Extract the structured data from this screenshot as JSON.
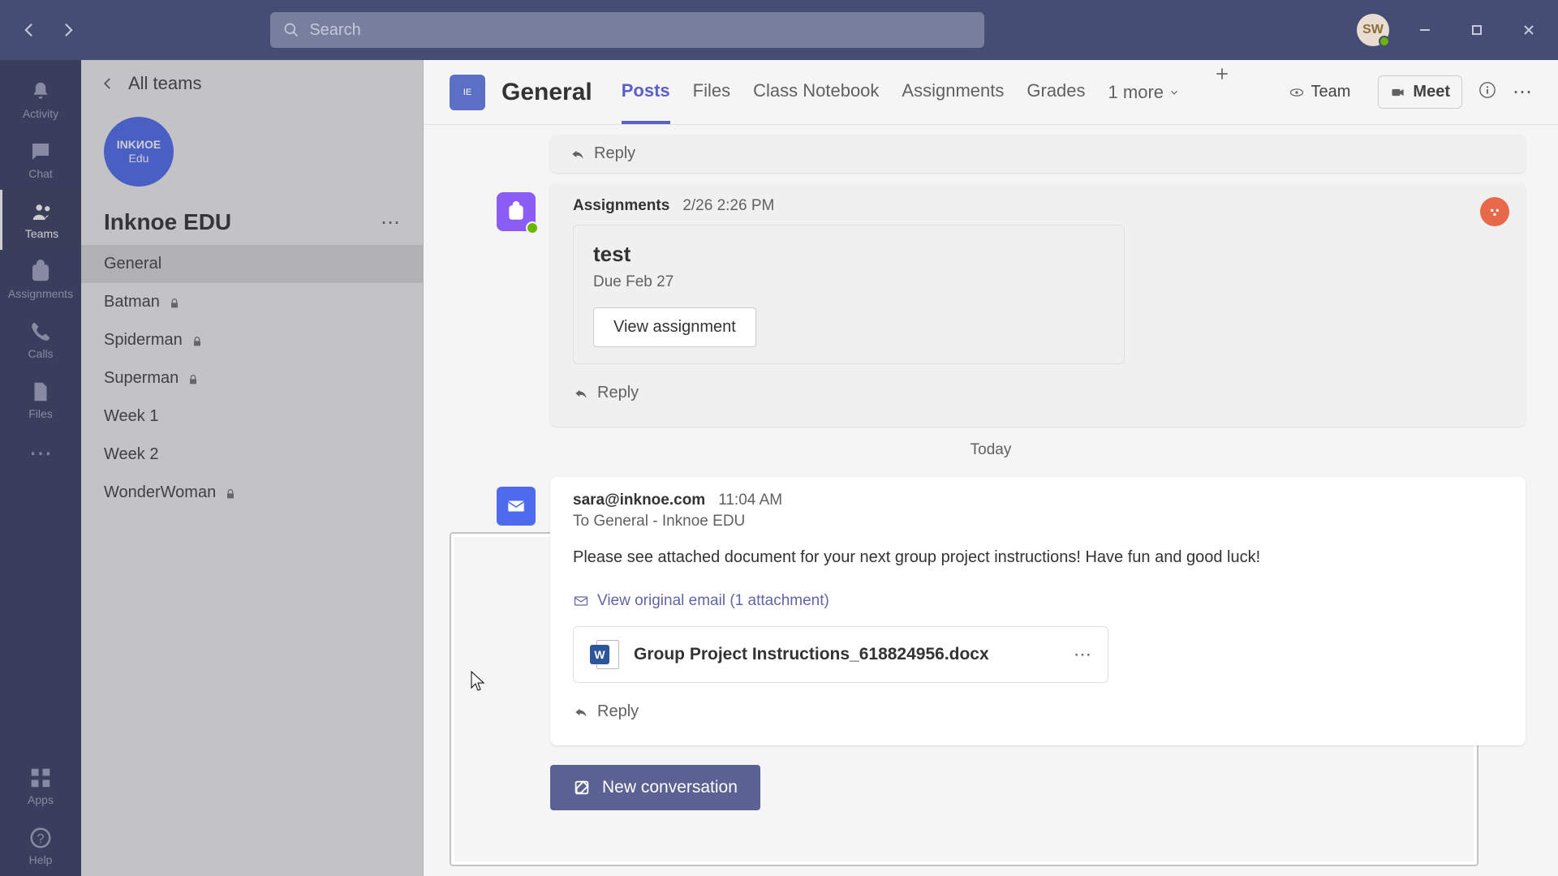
{
  "titlebar": {
    "search_placeholder": "Search",
    "avatar_initials": "SW"
  },
  "rail": {
    "activity": "Activity",
    "chat": "Chat",
    "teams": "Teams",
    "assignments": "Assignments",
    "calls": "Calls",
    "files": "Files",
    "apps": "Apps",
    "help": "Help"
  },
  "sidebar": {
    "all_teams": "All teams",
    "team_avatar_line1": "INKИOE",
    "team_avatar_line2": "Edu",
    "team_name": "Inknoe EDU",
    "channels": [
      {
        "label": "General",
        "locked": false,
        "active": true
      },
      {
        "label": "Batman",
        "locked": true
      },
      {
        "label": "Spiderman",
        "locked": true
      },
      {
        "label": "Superman",
        "locked": true
      },
      {
        "label": "Week 1",
        "locked": false
      },
      {
        "label": "Week 2",
        "locked": false
      },
      {
        "label": "WonderWoman",
        "locked": true
      }
    ]
  },
  "header": {
    "channel_title": "General",
    "tabs": {
      "posts": "Posts",
      "files": "Files",
      "notebook": "Class Notebook",
      "assignments": "Assignments",
      "grades": "Grades",
      "more": "1 more"
    },
    "team_btn": "Team",
    "meet_btn": "Meet"
  },
  "messages": {
    "reply_label": "Reply",
    "assign": {
      "author": "Assignments",
      "time": "2/26 2:26 PM",
      "title": "test",
      "due": "Due Feb 27",
      "view_btn": "View assignment"
    },
    "date_separator": "Today",
    "email": {
      "from": "sara@inknoe.com",
      "time": "11:04 AM",
      "to": "To General - Inknoe EDU",
      "body": "Please see attached document for your next group project instructions! Have fun and good luck!",
      "view_original": "View original email (1 attachment)",
      "attachment_name": "Group Project Instructions_618824956.docx"
    },
    "new_convo": "New conversation"
  }
}
